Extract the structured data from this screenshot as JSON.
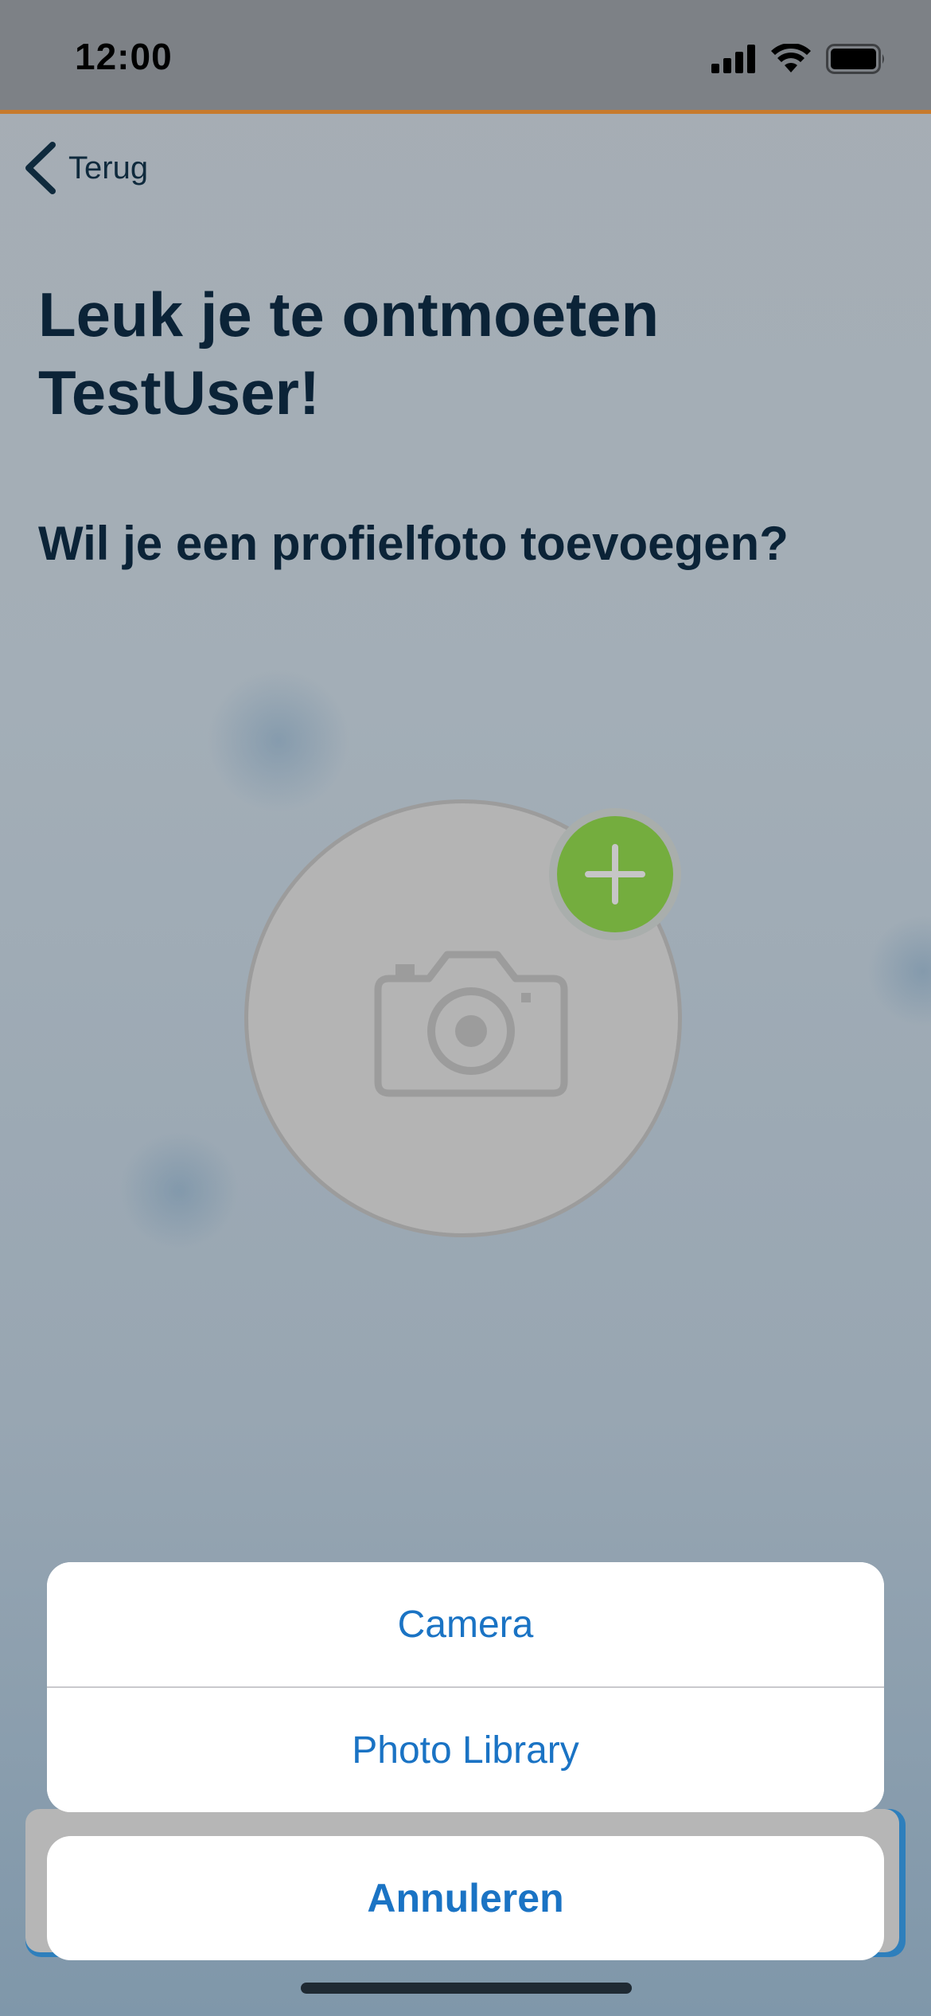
{
  "status_bar": {
    "time": "12:00",
    "icons": [
      "cellular-signal-icon",
      "wifi-icon",
      "battery-icon"
    ]
  },
  "nav": {
    "back_label": "Terug",
    "back_icon": "chevron-left-icon"
  },
  "page": {
    "title": "Leuk je te ontmoeten TestUser!",
    "subtitle": "Wil je een profielfoto toevoegen?",
    "avatar_icon": "camera-icon",
    "add_icon": "plus-icon"
  },
  "action_sheet": {
    "options": [
      {
        "label": "Camera"
      },
      {
        "label": "Photo Library"
      }
    ],
    "cancel_label": "Annuleren"
  },
  "colors": {
    "accent": "#1a73c4",
    "title": "#0b2337",
    "add_button": "#74ad3e",
    "status_border": "#c77a2c"
  }
}
